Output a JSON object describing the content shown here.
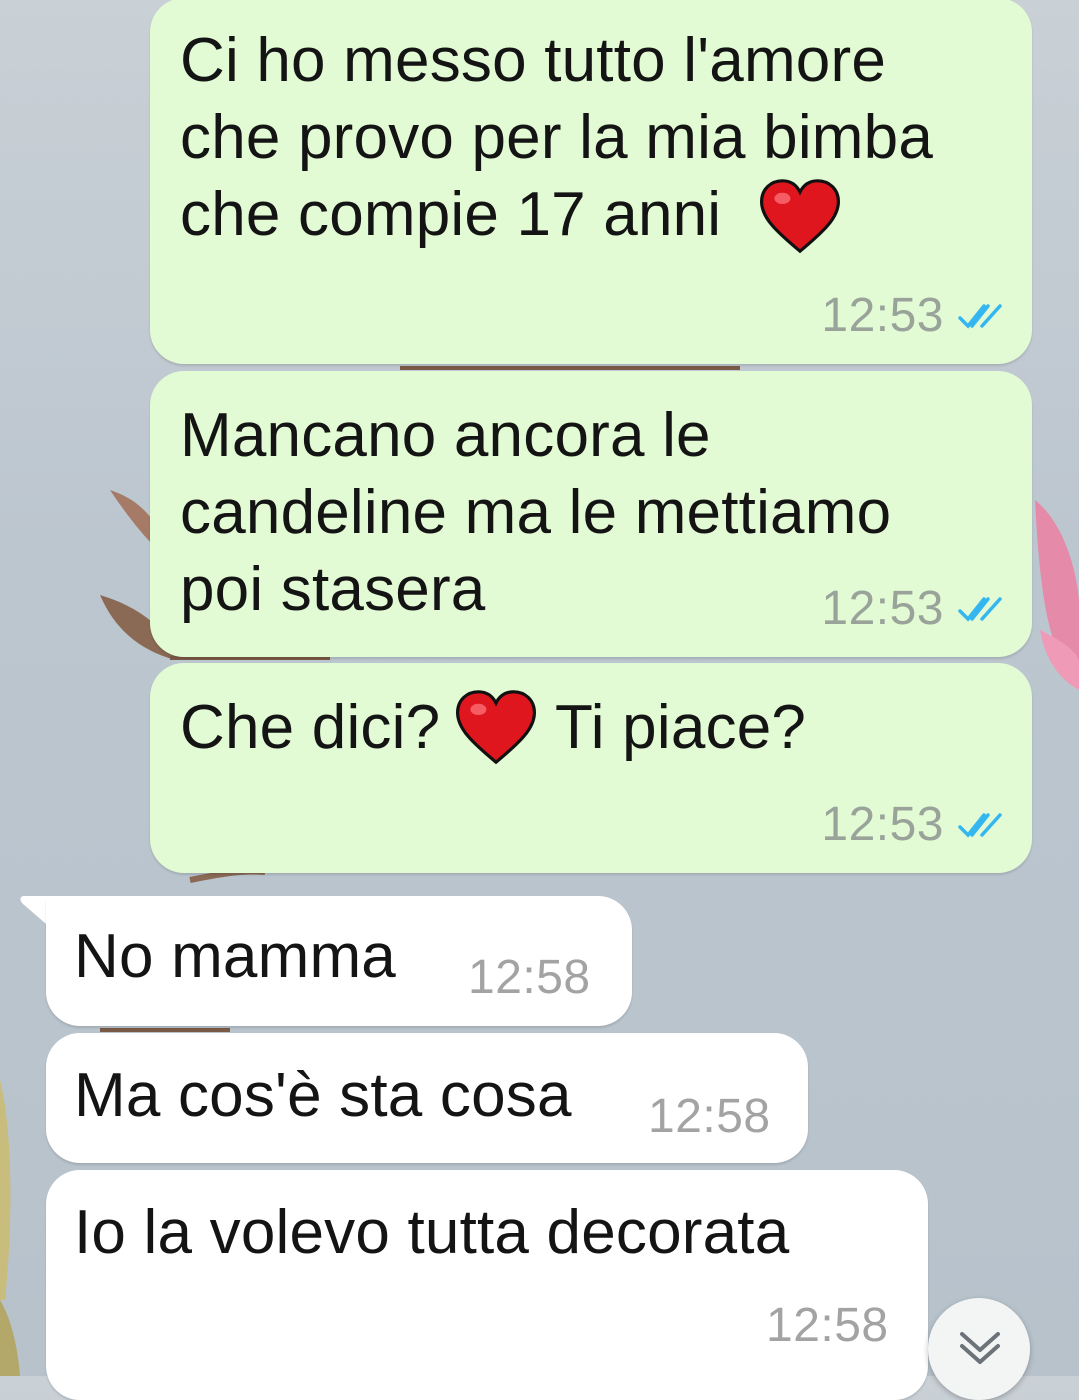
{
  "messages": [
    {
      "direction": "outgoing",
      "lines": [
        "Ci ho messo tutto l'amore",
        "che provo per la mia bimba",
        "che compie 17 anni"
      ],
      "time": "12:53",
      "status": "read",
      "trailing_emoji": "red-heart"
    },
    {
      "direction": "outgoing",
      "lines": [
        "Mancano ancora le",
        "candeline ma le mettiamo",
        "poi stasera"
      ],
      "time": "12:53",
      "status": "read"
    },
    {
      "direction": "outgoing",
      "text_before": "Che dici?",
      "text_after": "Ti piace?",
      "inline_emoji": "red-heart",
      "time": "12:53",
      "status": "read"
    },
    {
      "direction": "incoming",
      "text": "No mamma",
      "time": "12:58"
    },
    {
      "direction": "incoming",
      "text": "Ma cos'è sta cosa",
      "time": "12:58"
    },
    {
      "direction": "incoming",
      "text": "Io la volevo tutta decorata",
      "time": "12:58"
    }
  ],
  "scroll_button": {
    "icon": "double-chevron-down-icon"
  },
  "colors": {
    "outgoing_bubble": "#e2fbd4",
    "incoming_bubble": "#ffffff",
    "read_ticks": "#34b7f1",
    "heart": "#e0161f"
  }
}
